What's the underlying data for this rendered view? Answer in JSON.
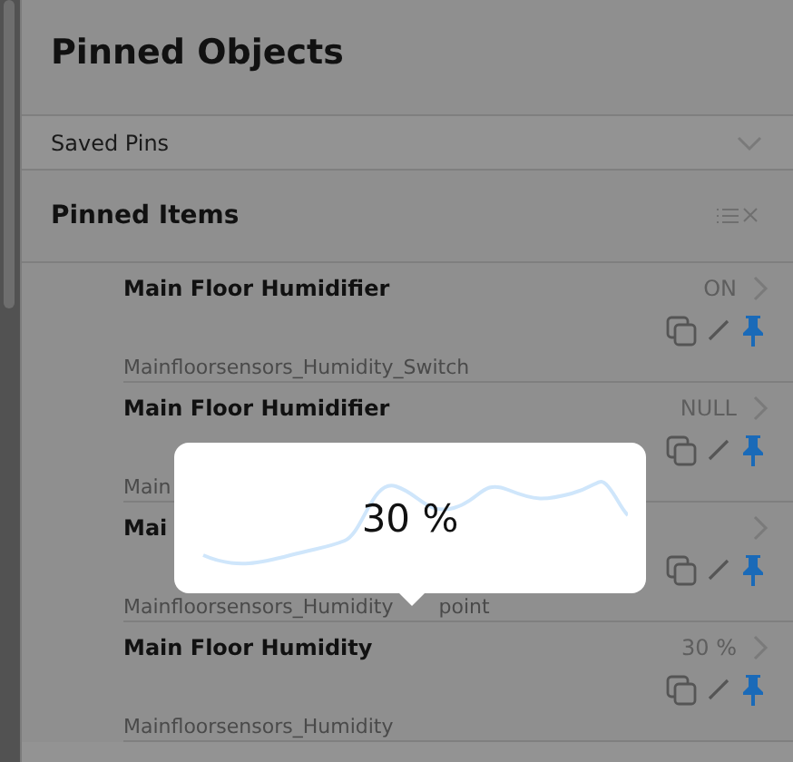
{
  "header": {
    "title": "Pinned Objects"
  },
  "saved_pins": {
    "label": "Saved Pins",
    "expanded": false
  },
  "pinned_items": {
    "title": "Pinned Items",
    "items": [
      {
        "name": "Main Floor Humidifier",
        "value": "ON",
        "sub": "Mainfloorsensors_Humidity_Switch",
        "pinned": true
      },
      {
        "name": "Main Floor Humidifier",
        "value": "NULL",
        "sub": "Main",
        "pinned": true
      },
      {
        "name": "Mai",
        "sub": "Mainfloorsensors_Humidity",
        "sub_tail": "point",
        "pinned": true
      },
      {
        "name": "Main Floor Humidity",
        "value": "30 %",
        "sub": "Mainfloorsensors_Humidity",
        "pinned": true
      }
    ]
  },
  "popup": {
    "value": "30 %"
  }
}
